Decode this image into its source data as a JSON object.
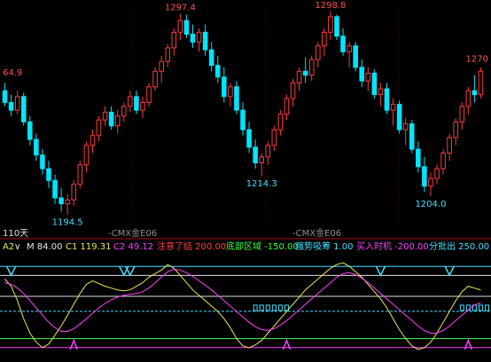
{
  "header": {
    "period_label": "110天",
    "indicator_name": "A2",
    "watermark": "-CMX金E06"
  },
  "indicator_bar": [
    {
      "text": "M 84.00",
      "color": "#e8e8e8"
    },
    {
      "text": "C1 119.31",
      "color": "#f0e64a"
    },
    {
      "text": "C2 49.12",
      "color": "#ff40ff"
    },
    {
      "text": "注意了结 200.00",
      "color": "#ff4040"
    },
    {
      "text": "底部区域 -150.00",
      "color": "#40ff40"
    },
    {
      "text": "强势吸筹 1.00",
      "color": "#40e0ff"
    },
    {
      "text": "买入时机 -200.00",
      "color": "#ff40ff"
    },
    {
      "text": "分批出 250.00",
      "color": "#40e0ff"
    }
  ],
  "colors": {
    "up": "#ff3b3b",
    "down": "#00e5ff",
    "bg": "#000000",
    "grid": "#8b0000"
  },
  "chart_data": [
    {
      "type": "candlestick",
      "title": "",
      "ylim": [
        1188,
        1300
      ],
      "price_labels": [
        {
          "text": "64.9",
          "color": "#ff5050"
        },
        {
          "text": "1297.4",
          "color": "#ff5050"
        },
        {
          "text": "1298.8",
          "color": "#ff5050"
        },
        {
          "text": "1270",
          "color": "#ff5050"
        },
        {
          "text": "1194.5",
          "color": "#40e0ff"
        },
        {
          "text": "1214.3",
          "color": "#40e0ff"
        },
        {
          "text": "1204.0",
          "color": "#40e0ff"
        }
      ],
      "candles": [
        [
          1258,
          1262,
          1250,
          1252
        ],
        [
          1252,
          1256,
          1245,
          1248
        ],
        [
          1248,
          1258,
          1246,
          1255
        ],
        [
          1255,
          1257,
          1240,
          1242
        ],
        [
          1242,
          1245,
          1230,
          1233
        ],
        [
          1233,
          1236,
          1222,
          1225
        ],
        [
          1225,
          1228,
          1215,
          1218
        ],
        [
          1218,
          1222,
          1208,
          1212
        ],
        [
          1212,
          1215,
          1200,
          1203
        ],
        [
          1203,
          1208,
          1196,
          1200
        ],
        [
          1200,
          1205,
          1194.5,
          1202
        ],
        [
          1202,
          1212,
          1199,
          1210
        ],
        [
          1210,
          1222,
          1208,
          1220
        ],
        [
          1220,
          1232,
          1216,
          1230
        ],
        [
          1230,
          1238,
          1226,
          1235
        ],
        [
          1235,
          1245,
          1232,
          1243
        ],
        [
          1243,
          1250,
          1240,
          1247
        ],
        [
          1247,
          1250,
          1238,
          1240
        ],
        [
          1240,
          1248,
          1236,
          1245
        ],
        [
          1245,
          1252,
          1242,
          1250
        ],
        [
          1250,
          1258,
          1247,
          1255
        ],
        [
          1255,
          1258,
          1246,
          1248
        ],
        [
          1248,
          1255,
          1244,
          1252
        ],
        [
          1252,
          1262,
          1250,
          1260
        ],
        [
          1260,
          1270,
          1258,
          1268
        ],
        [
          1268,
          1276,
          1262,
          1273
        ],
        [
          1273,
          1282,
          1270,
          1280
        ],
        [
          1280,
          1290,
          1276,
          1288
        ],
        [
          1288,
          1297.4,
          1284,
          1294
        ],
        [
          1294,
          1297,
          1285,
          1287
        ],
        [
          1287,
          1292,
          1280,
          1283
        ],
        [
          1283,
          1290,
          1278,
          1288
        ],
        [
          1288,
          1292,
          1276,
          1279
        ],
        [
          1279,
          1283,
          1268,
          1271
        ],
        [
          1271,
          1276,
          1262,
          1265
        ],
        [
          1265,
          1270,
          1252,
          1255
        ],
        [
          1255,
          1262,
          1250,
          1260
        ],
        [
          1260,
          1263,
          1246,
          1248
        ],
        [
          1248,
          1252,
          1235,
          1238
        ],
        [
          1238,
          1242,
          1226,
          1229
        ],
        [
          1229,
          1233,
          1218,
          1221
        ],
        [
          1221,
          1226,
          1214.3,
          1224
        ],
        [
          1224,
          1232,
          1220,
          1230
        ],
        [
          1230,
          1240,
          1227,
          1238
        ],
        [
          1238,
          1248,
          1235,
          1246
        ],
        [
          1246,
          1256,
          1243,
          1254
        ],
        [
          1254,
          1264,
          1250,
          1262
        ],
        [
          1262,
          1270,
          1258,
          1268
        ],
        [
          1268,
          1275,
          1262,
          1266
        ],
        [
          1266,
          1276,
          1263,
          1274
        ],
        [
          1274,
          1283,
          1270,
          1281
        ],
        [
          1281,
          1290,
          1276,
          1288
        ],
        [
          1288,
          1298.8,
          1284,
          1296
        ],
        [
          1296,
          1297,
          1284,
          1286
        ],
        [
          1286,
          1290,
          1276,
          1278
        ],
        [
          1278,
          1283,
          1270,
          1281
        ],
        [
          1281,
          1283,
          1268,
          1270
        ],
        [
          1270,
          1274,
          1260,
          1263
        ],
        [
          1263,
          1270,
          1258,
          1267
        ],
        [
          1267,
          1269,
          1254,
          1256
        ],
        [
          1256,
          1262,
          1250,
          1259
        ],
        [
          1259,
          1262,
          1246,
          1248
        ],
        [
          1248,
          1254,
          1240,
          1251
        ],
        [
          1251,
          1253,
          1236,
          1238
        ],
        [
          1238,
          1244,
          1230,
          1241
        ],
        [
          1241,
          1243,
          1226,
          1228
        ],
        [
          1228,
          1232,
          1216,
          1219
        ],
        [
          1219,
          1224,
          1206,
          1209
        ],
        [
          1209,
          1216,
          1204.0,
          1213
        ],
        [
          1213,
          1220,
          1210,
          1218
        ],
        [
          1218,
          1228,
          1215,
          1226
        ],
        [
          1226,
          1236,
          1222,
          1234
        ],
        [
          1234,
          1244,
          1230,
          1242
        ],
        [
          1242,
          1252,
          1238,
          1250
        ],
        [
          1250,
          1260,
          1246,
          1258
        ],
        [
          1258,
          1266,
          1252,
          1256
        ],
        [
          1256,
          1270,
          1254,
          1268
        ]
      ]
    },
    {
      "type": "line",
      "title": "A2",
      "ylim": [
        -260,
        320
      ],
      "reference_lines": [
        {
          "name": "分批出",
          "value": 250,
          "color": "#40e0ff",
          "style": "solid"
        },
        {
          "name": "注意了结",
          "value": 200,
          "color": "#e0e0e0",
          "style": "solid"
        },
        {
          "name": "M",
          "value": 84,
          "color": "#e0e0e0",
          "style": "solid"
        },
        {
          "name": "强势吸筹",
          "value": 1,
          "color": "#40e0ff",
          "style": "dashed"
        },
        {
          "name": "底部区域",
          "value": -150,
          "color": "#40ff40",
          "style": "solid"
        },
        {
          "name": "买入时机",
          "value": -200,
          "color": "#ff40ff",
          "style": "solid"
        }
      ],
      "series": [
        {
          "name": "C1",
          "color": "#f0e64a",
          "values": [
            180,
            140,
            60,
            -40,
            -120,
            -170,
            -200,
            -180,
            -130,
            -80,
            -20,
            40,
            100,
            150,
            170,
            155,
            140,
            130,
            120,
            115,
            120,
            140,
            160,
            190,
            210,
            230,
            260,
            240,
            200,
            160,
            120,
            90,
            60,
            30,
            0,
            -40,
            -90,
            -150,
            -190,
            -200,
            -185,
            -160,
            -120,
            -80,
            -40,
            0,
            40,
            80,
            120,
            150,
            180,
            210,
            240,
            260,
            270,
            250,
            220,
            190,
            150,
            110,
            70,
            20,
            -40,
            -100,
            -150,
            -190,
            -210,
            -200,
            -170,
            -120,
            -60,
            0,
            60,
            110,
            140,
            130,
            119
          ]
        },
        {
          "name": "C2",
          "color": "#ff40ff",
          "values": [
            160,
            150,
            130,
            100,
            60,
            20,
            -20,
            -60,
            -90,
            -110,
            -110,
            -95,
            -70,
            -40,
            -10,
            20,
            45,
            65,
            80,
            90,
            95,
            100,
            110,
            130,
            160,
            190,
            220,
            235,
            230,
            215,
            195,
            170,
            145,
            120,
            90,
            60,
            30,
            0,
            -30,
            -60,
            -85,
            -100,
            -105,
            -95,
            -75,
            -50,
            -20,
            10,
            40,
            70,
            100,
            130,
            160,
            190,
            210,
            215,
            205,
            185,
            160,
            130,
            100,
            70,
            40,
            10,
            -20,
            -50,
            -80,
            -105,
            -120,
            -120,
            -105,
            -80,
            -50,
            -20,
            10,
            35,
            49
          ]
        }
      ],
      "signals": {
        "top_markers": [
          1,
          19,
          20,
          60,
          71
        ],
        "bottom_markers": [
          11,
          45,
          74
        ],
        "strong_bar_ranges": [
          [
            40,
            45
          ],
          [
            73,
            79
          ]
        ]
      }
    }
  ]
}
